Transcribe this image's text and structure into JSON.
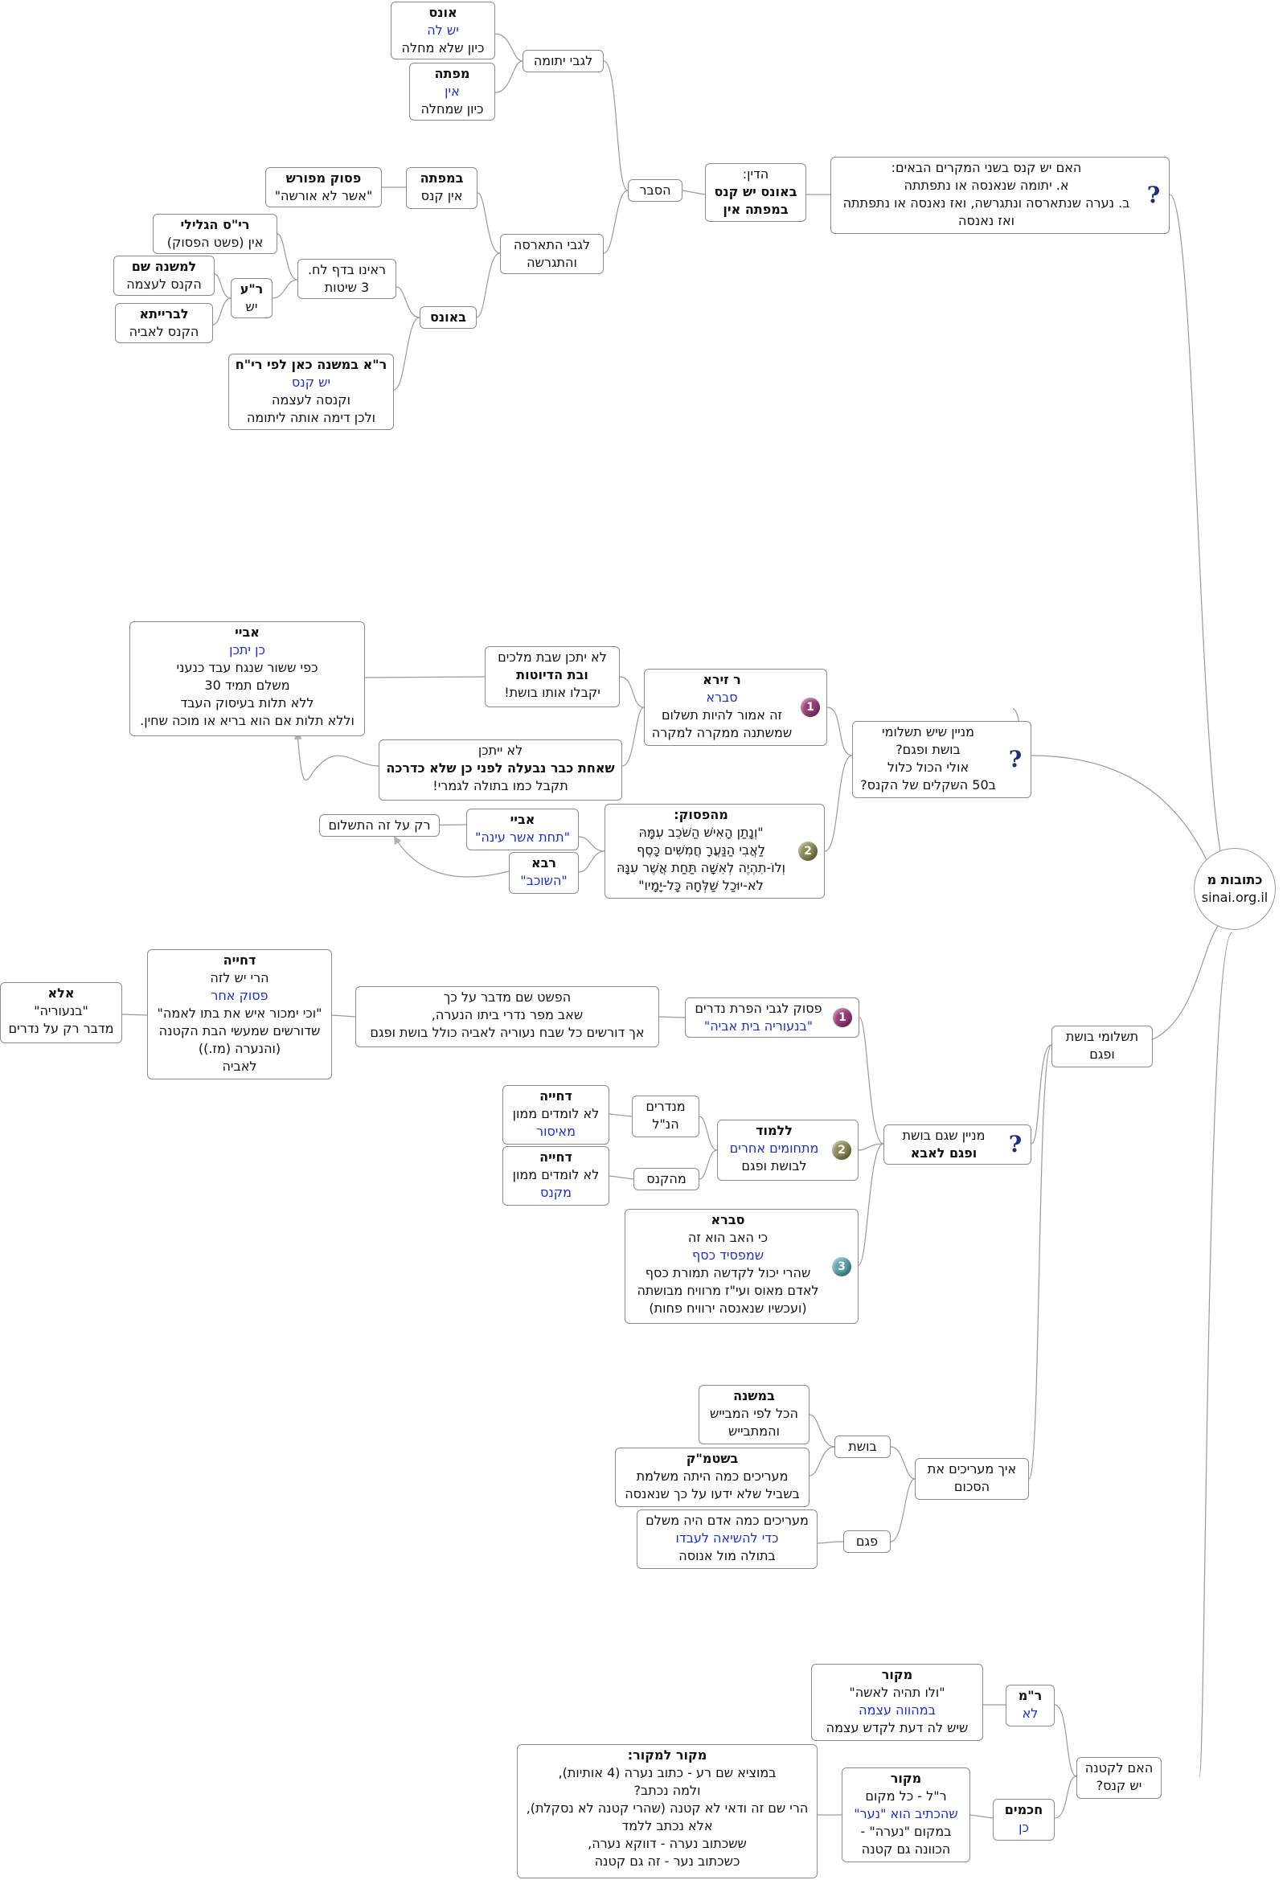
{
  "root": {
    "title": "כתובות מ",
    "subtitle": "sinai.org.il"
  },
  "section1": {
    "question": [
      "האם יש קנס בשני המקרים הבאים:",
      "א.  יתומה שנאנסה או נתפתתה",
      "ב. נערה שנתארסה ונתגרשה, ואז נאנסה או נתפתתה",
      "ואז נאנסה"
    ],
    "ruling": [
      "הדין:",
      "באונס יש קנס",
      "במפתה אין"
    ],
    "reason": "הסבר",
    "orphan": "לגבי יתומה",
    "ones_a": [
      "אונס",
      "יש לה",
      "כיון שלא מחלה"
    ],
    "mefate_a": [
      "מפתה",
      "אין",
      "כיון שמחלה"
    ],
    "divorced": [
      "לגבי התארסה",
      "והתגרשה"
    ],
    "mefate_b": [
      "במפתה",
      "אין קנס"
    ],
    "explicit": [
      "פסוק מפורש",
      "\"אשר לא אורשה\""
    ],
    "ones_b": "באונס",
    "three": [
      "ראינו בדף לח.",
      "3 שיטות"
    ],
    "rys": [
      "רי\"ס הגלילי",
      "אין (פשט הפסוק)"
    ],
    "ra": [
      "ר\"ע",
      "יש"
    ],
    "mishna_shem": [
      "למשנה שם",
      "הקנס לעצמה"
    ],
    "braita": [
      "לברייתא",
      "הקנס לאביה"
    ],
    "rya": [
      "ר\"א במשנה כאן לפי רי\"ח",
      "יש קנס",
      "וקנסה לעצמה",
      "ולכן דימה אותה ליתומה"
    ]
  },
  "section2": {
    "question": [
      "מניין שיש תשלומי",
      "בושת ופגם?",
      "אולי הכול כלול",
      "ב50 השקלים של הקנס?"
    ],
    "rzera": [
      "ר זירא",
      "סברא",
      "זה אמור להיות תשלום",
      "שמשתנה ממקרה למקרה"
    ],
    "kings": [
      "לא יתכן שבת מלכים",
      "ובת הדיוטות",
      "יקבלו אותו בושת!"
    ],
    "abaye1": [
      "אביי",
      "כן יתכן",
      "כפי ששור שנגח עבד כנעני",
      "משלם תמיד 30",
      "ללא תלות בעיסוק העבד",
      "וללא תלות אם הוא בריא או מוכה שחין."
    ],
    "impossible": [
      "לא ייתכן",
      "שאחת כבר נבעלה לפני כן שלא כדרכה",
      "תקבל כמו בתולה לגמרי!"
    ],
    "verse": [
      "מהפסוק:",
      "\"וְנָתַן הָאִישׁ הַשֹּׁכֵב עִמָּהּ",
      "לַאֲבִי הַנַּעֲרָ חֲמִשִּׁים כָּסֶף",
      "וְלוֹ-תִהְיֶה לְאִשָּׁה תַּחַת אֲשֶׁר עִנָּהּ",
      "לֹא-יוּכַל שַׁלְּחָהּ כָּל-יָמָיו\""
    ],
    "abaye2": [
      "אביי",
      "\"תחת אשר עינה\""
    ],
    "rava": [
      "רבא",
      "\"השוכב\""
    ],
    "only": "רק על זה התשלום"
  },
  "section3": {
    "question": [
      "מניין שגם בושת",
      "ופגם לאבא"
    ],
    "neder": [
      "פסוק לגבי הפרת נדרים",
      "\"בנעוריה בית אביה\""
    ],
    "pshat": [
      "הפשט שם מדבר על כך",
      "שאב מפר נדרי ביתו הנערה,",
      "אך דורשים  כל שבח נעוריה לאביה כולל בושת ופגם"
    ],
    "dachya1": [
      "דחייה",
      "הרי יש לזה",
      "פסוק אחר",
      "\"וכי ימכור איש את בתו לאמה\"",
      "שדורשים שמעשי הבת הקטנה",
      "(והנערה (מז.))",
      "לאביה"
    ],
    "ela": [
      "אלא",
      "\"בנעוריה\"",
      "מדבר רק על נדרים"
    ],
    "lilmod": [
      "ללמוד",
      "מתחומים אחרים",
      "לבושת ופגם"
    ],
    "madrim": [
      "מנדרים",
      "הנ\"ל"
    ],
    "dachya2": [
      "דחייה",
      "לא לומדים ממון",
      "מאיסור"
    ],
    "mehaknas": "מהקנס",
    "dachya3": [
      "דחייה",
      "לא לומדים ממון",
      "מקנס"
    ],
    "svara": [
      "סברא",
      "כי האב הוא זה",
      "שמפסיד כסף",
      "שהרי יכול לקדשה תמורת כסף",
      "לאדם מאוס  ועי\"ז מרוויח מבושתה",
      "(ועכשיו שנאנסה ירוויח פחות)"
    ]
  },
  "section4": {
    "hub": [
      "תשלומי בושת",
      "ופגם"
    ],
    "evaluate": [
      "איך מעריכים את",
      "הסכום"
    ],
    "boshet": "בושת",
    "bamishna": [
      "במשנה",
      "הכל לפי המבייש",
      "והמתבייש"
    ],
    "bashitmak": [
      "בשטמ\"ק",
      "מעריכים כמה היתה משלמת",
      "בשביל שלא ידעו על כך שנאנסה"
    ],
    "pgam": "פגם",
    "pgam_desc": [
      "מעריכים כמה אדם היה משלם",
      "כדי להשיאה לעבדו",
      "בתולה מול אנוסה"
    ]
  },
  "section5": {
    "question": [
      "האם לקטנה",
      "יש קנס?"
    ],
    "rm": [
      "ר\"מ",
      "לא"
    ],
    "makor": [
      "מקור",
      "\"ולו תהיה  לאשה\"",
      "במהווה עצמה",
      "שיש לה דעת  לקדש עצמה"
    ],
    "hachamim": [
      "חכמים",
      "כן"
    ],
    "makor2": [
      "מקור",
      "ר\"ל - כל מקום",
      "שהכתיב הוא \"נער\"",
      "במקום \"נערה\" -",
      "הכוונה גם קטנה"
    ],
    "makor3": [
      "מקור למקור:",
      "במוציא שם רע - כתוב נערה (4 אותיות),",
      "ולמה נכתב?",
      "הרי שם זה ודאי לא קטנה (שהרי קטנה לא נסקלת),",
      "אלא נכתב ללמד",
      "ששכתוב נערה - דווקא נערה,",
      "כשכתוב נער - זה גם קטנה"
    ]
  }
}
